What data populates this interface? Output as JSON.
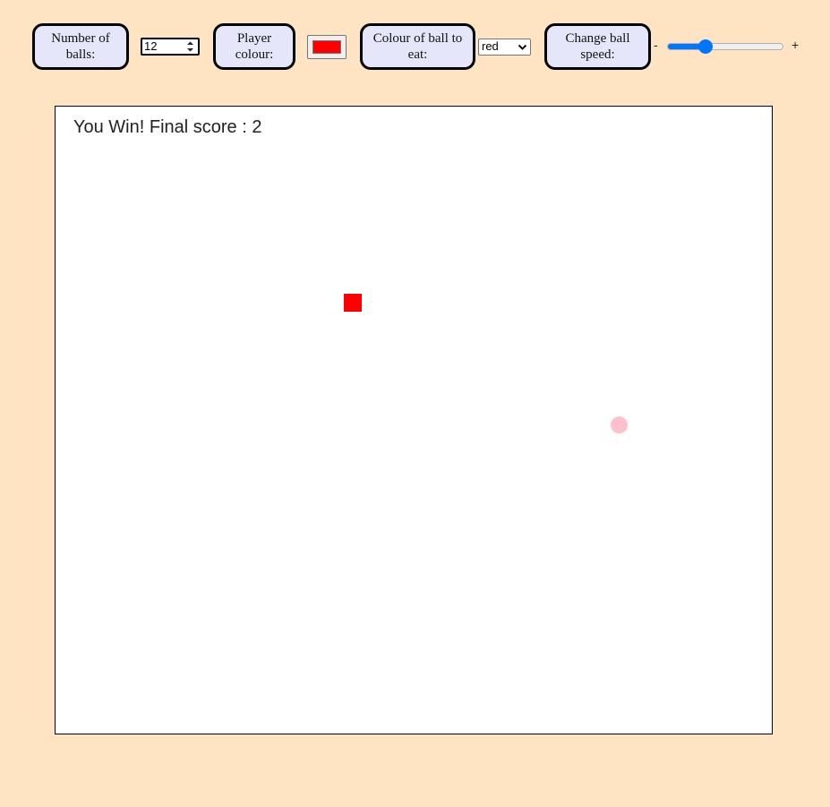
{
  "controls": {
    "num_balls_label": "Number of balls:",
    "num_balls_value": "12",
    "player_colour_label": "Player colour:",
    "player_colour_value": "#ff0000",
    "ball_to_eat_label": "Colour of ball to eat:",
    "ball_to_eat_selected": "red",
    "ball_speed_label": "Change ball speed:",
    "speed_minus": "-",
    "speed_plus": "+",
    "speed_level": 0.33
  },
  "game": {
    "status_text": "You Win! Final score : 2",
    "player_color": "#ff0000",
    "ball_color": "#ffc0cb"
  },
  "colors": {
    "page_background": "#ffe4c4",
    "label_background": "#e6e6fa",
    "slider_accent": "#0075ff"
  }
}
